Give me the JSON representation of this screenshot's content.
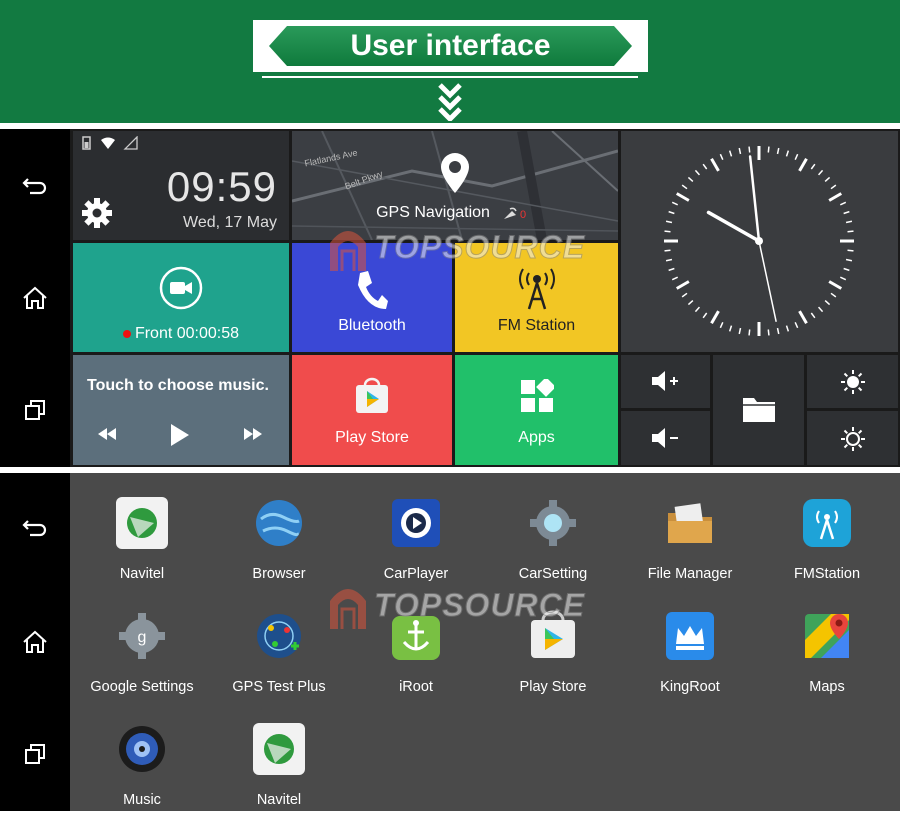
{
  "header": {
    "title": "User interface"
  },
  "nav": {
    "back_icon": "back-icon",
    "home_icon": "home-icon",
    "recents_icon": "recents-icon"
  },
  "launcher": {
    "status_icons": [
      "battery-icon",
      "wifi-icon",
      "signal-icon"
    ],
    "clock": {
      "time": "09:59",
      "date": "Wed, 17 May"
    },
    "gps": {
      "label": "GPS Navigation",
      "icon": "location-pin-icon"
    },
    "camera": {
      "label": "Front 00:00:58",
      "icon": "video-camera-icon"
    },
    "bluetooth": {
      "label": "Bluetooth",
      "icon": "phone-icon"
    },
    "fm": {
      "label": "FM Station",
      "icon": "radio-tower-icon"
    },
    "music": {
      "label": "Touch to choose music."
    },
    "playstore": {
      "label": "Play Store"
    },
    "apps": {
      "label": "Apps"
    },
    "analog_clock": {
      "hour": 9,
      "minute": 59
    },
    "controls": [
      "volume-up-icon",
      "volume-down-icon",
      "folder-icon",
      "brightness-up-icon",
      "brightness-down-icon"
    ],
    "map_labels": [
      "Flatlands Ave",
      "Belt Pkwy"
    ]
  },
  "drawer": {
    "apps": [
      {
        "name": "Navitel",
        "icon": "navitel-icon"
      },
      {
        "name": "Browser",
        "icon": "browser-icon"
      },
      {
        "name": "CarPlayer",
        "icon": "carplayer-icon"
      },
      {
        "name": "CarSetting",
        "icon": "carsetting-icon"
      },
      {
        "name": "File Manager",
        "icon": "file-manager-icon"
      },
      {
        "name": "FMStation",
        "icon": "fmstation-icon"
      },
      {
        "name": "Google Settings",
        "icon": "google-settings-icon"
      },
      {
        "name": "GPS Test Plus",
        "icon": "gps-test-icon"
      },
      {
        "name": "iRoot",
        "icon": "iroot-icon"
      },
      {
        "name": "Play Store",
        "icon": "play-store-icon"
      },
      {
        "name": "KingRoot",
        "icon": "kingroot-icon"
      },
      {
        "name": "Maps",
        "icon": "maps-icon"
      },
      {
        "name": "Music",
        "icon": "music-icon"
      },
      {
        "name": "Navitel",
        "icon": "navitel-icon"
      }
    ]
  },
  "watermark": {
    "text": "TOPSOURCE"
  },
  "colors": {
    "header_green": "#127a41",
    "camera_teal": "#1fa38d",
    "bt_blue": "#3a48d6",
    "fm_yellow": "#f2c624",
    "play_red": "#f04c4c",
    "apps_green": "#21c06a"
  }
}
